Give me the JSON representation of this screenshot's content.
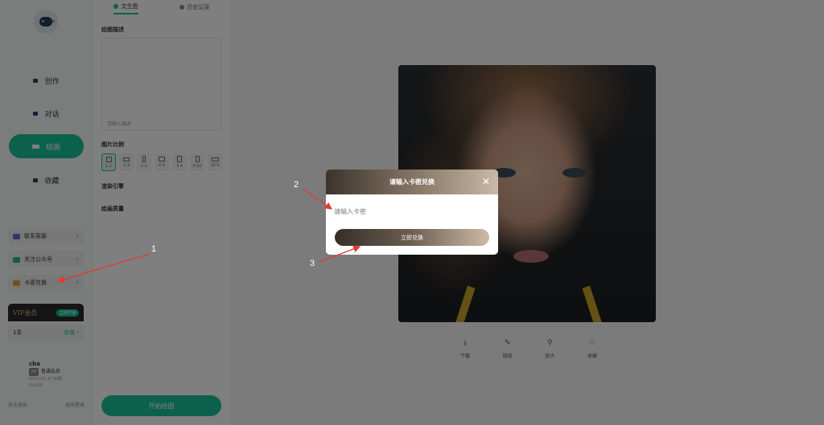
{
  "sidebar": {
    "nav": [
      {
        "label": "创作",
        "icon": "create-icon"
      },
      {
        "label": "对话",
        "icon": "chat-icon"
      },
      {
        "label": "绘画",
        "icon": "painting-icon",
        "active": true
      },
      {
        "label": "收藏",
        "icon": "favorite-icon"
      }
    ],
    "links": [
      {
        "label": "联系客服",
        "icon": "customer-service-icon"
      },
      {
        "label": "关注公众号",
        "icon": "wechat-icon"
      },
      {
        "label": "卡密兑换",
        "icon": "card-icon"
      }
    ],
    "vip": {
      "label": "VIP会员",
      "badge": "立即开通"
    },
    "balance": {
      "label": "1条",
      "link": "充值"
    },
    "user": {
      "name": "cba",
      "level_tag": "VIP",
      "level": "普通会员",
      "meta1": "2024-01-17 到期",
      "meta2": "ID:206"
    },
    "footer": {
      "left": "安全退出",
      "right": "退出登录"
    }
  },
  "panel": {
    "tabs": [
      {
        "label": "文生图",
        "active": true
      },
      {
        "label": "历史记录",
        "active": false
      }
    ],
    "desc_label": "绘图描述",
    "desc_hint": "请输入描述",
    "ratio_label": "图片比例",
    "ratios": [
      "1:1",
      "2:3",
      "1:2",
      "4:3",
      "3:4",
      "9:16",
      "16:9"
    ],
    "engine_label": "渲染引擎",
    "quality_label": "绘画质量",
    "draw_button": "开始绘图"
  },
  "main": {
    "actions": [
      {
        "label": "下载",
        "icon": "download-icon"
      },
      {
        "label": "链接",
        "icon": "link-icon"
      },
      {
        "label": "放大",
        "icon": "zoom-icon"
      },
      {
        "label": "收藏",
        "icon": "heart-icon"
      }
    ]
  },
  "modal": {
    "title": "请输入卡密兑换",
    "input_placeholder": "请输入卡密",
    "button": "立即兑换"
  },
  "annotations": [
    "1",
    "2",
    "3"
  ],
  "colors": {
    "accent": "#19c29a",
    "arrow": "#e53a2f",
    "overlay": "rgba(0,0,0,0.5)"
  }
}
